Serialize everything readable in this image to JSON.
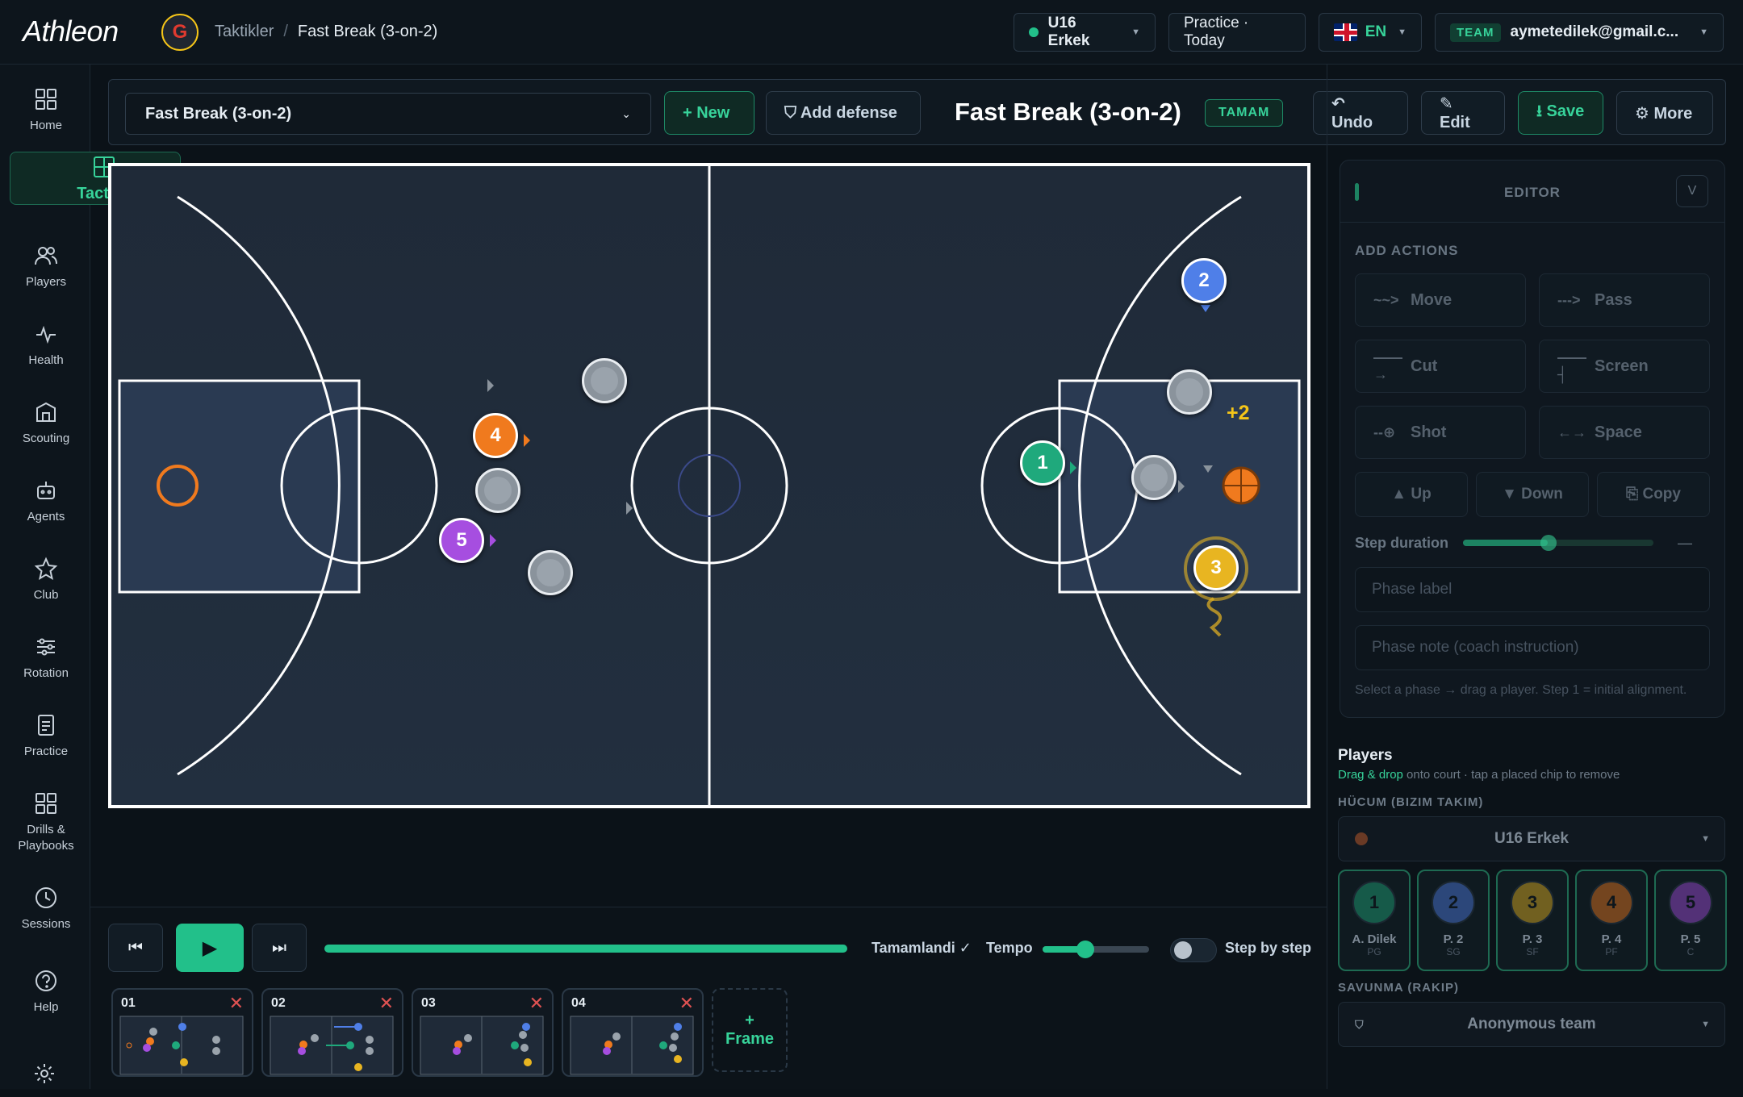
{
  "app": {
    "logo": "Athleon",
    "club_letter": "G"
  },
  "breadcrumb": {
    "parent": "Taktikler",
    "sep": "/",
    "current": "Fast Break (3-on-2)"
  },
  "header": {
    "team_select": "U16 Erkek",
    "practice": "Practice · Today",
    "lang": "EN",
    "team_tag": "TEAM",
    "email": "aymetedilek@gmail.c..."
  },
  "sidebar": {
    "items": [
      {
        "label": "Home",
        "icon": "home-icon"
      },
      {
        "label": "Tactics",
        "icon": "tactics-icon",
        "active": true
      },
      {
        "label": "Players",
        "icon": "players-icon"
      },
      {
        "label": "Health",
        "icon": "health-icon"
      },
      {
        "label": "Scouting",
        "icon": "scouting-icon"
      },
      {
        "label": "Agents",
        "icon": "agents-icon"
      },
      {
        "label": "Club",
        "icon": "star-icon"
      },
      {
        "label": "Rotation",
        "icon": "sliders-icon"
      },
      {
        "label": "Practice",
        "icon": "document-icon"
      },
      {
        "label": "Drills &\nPlaybooks",
        "icon": "grid-icon"
      },
      {
        "label": "Sessions",
        "icon": "clock-icon"
      },
      {
        "label": "Help",
        "icon": "help-icon"
      }
    ]
  },
  "toolbar": {
    "play_select": "Fast Break (3-on-2)",
    "new": "+ New",
    "add_defense": "⛉ Add defense",
    "title": "Fast Break (3-on-2)",
    "status": "TAMAM",
    "undo": "↶ Undo",
    "edit": "✎ Edit",
    "save": "⭳ Save",
    "more": "⚙ More"
  },
  "court": {
    "offense": [
      {
        "num": "1",
        "color": "#1fa97c"
      },
      {
        "num": "2",
        "color": "#4f7fe8"
      },
      {
        "num": "3",
        "color": "#e8b521"
      },
      {
        "num": "4",
        "color": "#f07a1e"
      },
      {
        "num": "5",
        "color": "#a64ee0"
      }
    ],
    "badge": "+2"
  },
  "editor": {
    "title": "EDITOR",
    "toggle": "V",
    "section": "ADD ACTIONS",
    "actions": [
      {
        "label": "Move",
        "icon": "~~>"
      },
      {
        "label": "Pass",
        "icon": "--->"
      },
      {
        "label": "Cut",
        "icon": "——→"
      },
      {
        "label": "Screen",
        "icon": "——┤"
      },
      {
        "label": "Shot",
        "icon": "--⊕"
      },
      {
        "label": "Space",
        "icon": "←→"
      }
    ],
    "up": "▲ Up",
    "down": "▼ Down",
    "copy": "⎘ Copy",
    "step_duration": "Step duration",
    "step_dash": "—",
    "phase_label_ph": "Phase label",
    "phase_note_ph": "Phase note (coach instruction)",
    "hint": "Select a phase → drag a player. Step 1 = initial alignment."
  },
  "players": {
    "title": "Players",
    "hint_strong": "Drag & drop",
    "hint": " onto court · tap a placed chip to remove",
    "offense_label": "HÜCUM (BIZIM TAKIM)",
    "offense_team": "U16 Erkek",
    "cards": [
      {
        "num": "1",
        "name": "A. Dilek",
        "pos": "PG",
        "color": "#1fa97c"
      },
      {
        "num": "2",
        "name": "P. 2",
        "pos": "SG",
        "color": "#4f7fe8"
      },
      {
        "num": "3",
        "name": "P. 3",
        "pos": "SF",
        "color": "#e8b521"
      },
      {
        "num": "4",
        "name": "P. 4",
        "pos": "PF",
        "color": "#f07a1e"
      },
      {
        "num": "5",
        "name": "P. 5",
        "pos": "C",
        "color": "#a64ee0"
      }
    ],
    "defense_label": "SAVUNMA (RAKIP)",
    "defense_team": "Anonymous team"
  },
  "playback": {
    "status": "Tamamlandi ✓",
    "tempo": "Tempo",
    "step": "Step by step",
    "progress": 1.0
  },
  "frames": [
    {
      "label": "01"
    },
    {
      "label": "02"
    },
    {
      "label": "03"
    },
    {
      "label": "04"
    }
  ],
  "add_frame": {
    "plus": "+",
    "label": "Frame"
  }
}
